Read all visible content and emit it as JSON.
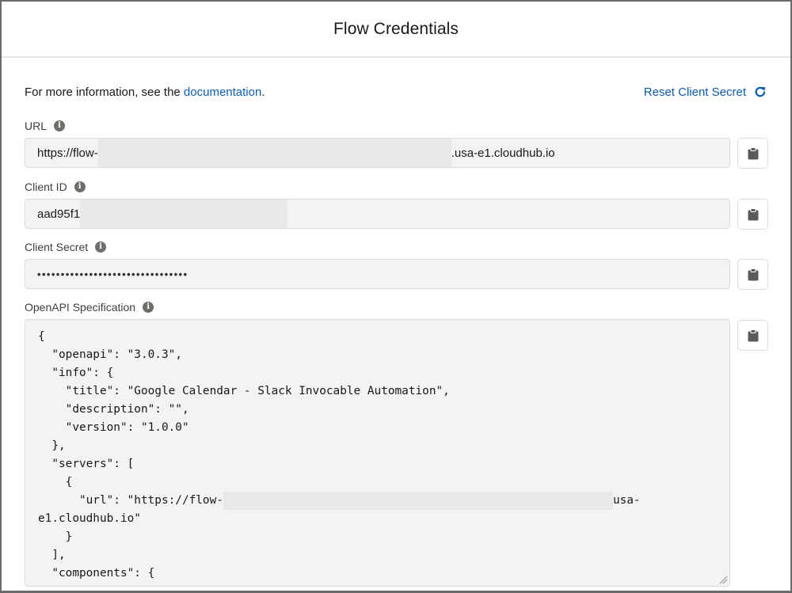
{
  "header": {
    "title": "Flow Credentials"
  },
  "intro": {
    "text": "For more information, see the ",
    "link_label": "documentation",
    "suffix": "."
  },
  "reset": {
    "label": "Reset Client Secret",
    "icon": "refresh-icon"
  },
  "fields": {
    "url": {
      "label": "URL",
      "value_prefix": "https://flow-",
      "value_suffix": ".usa-e1.cloudhub.io",
      "redacted": true
    },
    "client_id": {
      "label": "Client ID",
      "value_prefix": "aad95f1",
      "redacted": true
    },
    "client_secret": {
      "label": "Client Secret",
      "value": "••••••••••••••••••••••••••••••••"
    },
    "openapi": {
      "label": "OpenAPI Specification",
      "lines": [
        "{",
        "  \"openapi\": \"3.0.3\",",
        "  \"info\": {",
        "    \"title\": \"Google Calendar - Slack Invocable Automation\",",
        "    \"description\": \"\",",
        "    \"version\": \"1.0.0\"",
        "  },",
        "  \"servers\": [",
        "    {",
        "      \"url\": \"https://flow-",
        "e1.cloudhub.io\"",
        "    }",
        "  ],",
        "  \"components\": {"
      ],
      "redacted_line_suffix": "usa-"
    }
  },
  "copy_button": {
    "icon": "clipboard-icon"
  },
  "info_icon": {
    "glyph": "i"
  },
  "colors": {
    "link": "#0b5cab",
    "field_bg": "#f3f3f3",
    "icon_gray": "#706e6b"
  }
}
